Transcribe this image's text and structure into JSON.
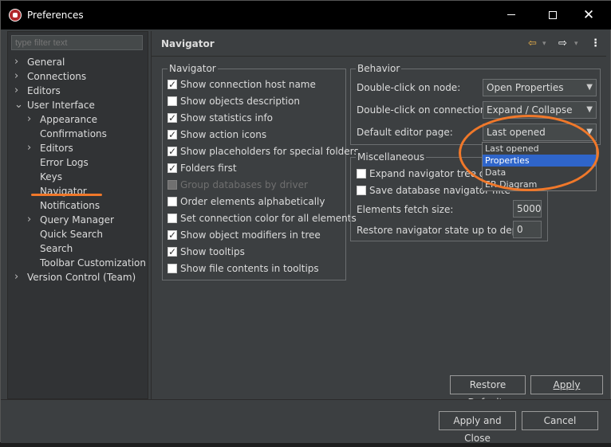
{
  "window": {
    "title": "Preferences",
    "minimize": "—",
    "close": "✕"
  },
  "filter": {
    "placeholder": "type filter text"
  },
  "tree": {
    "items": [
      {
        "label": "General"
      },
      {
        "label": "Connections"
      },
      {
        "label": "Editors"
      },
      {
        "label": "User Interface"
      },
      {
        "label": "Appearance"
      },
      {
        "label": "Confirmations"
      },
      {
        "label": "Editors"
      },
      {
        "label": "Error Logs"
      },
      {
        "label": "Keys"
      },
      {
        "label": "Navigator"
      },
      {
        "label": "Notifications"
      },
      {
        "label": "Query Manager"
      },
      {
        "label": "Quick Search"
      },
      {
        "label": "Search"
      },
      {
        "label": "Toolbar Customization"
      },
      {
        "label": "Version Control (Team)"
      }
    ]
  },
  "header": {
    "title": "Navigator",
    "back": "⇦",
    "forward": "⇨",
    "menu": "⋮",
    "dropdown": "▾"
  },
  "navigator_group": {
    "label": "Navigator",
    "options": [
      {
        "label": "Show connection host name",
        "checked": true
      },
      {
        "label": "Show objects description",
        "checked": false
      },
      {
        "label": "Show statistics info",
        "checked": true
      },
      {
        "label": "Show action icons",
        "checked": true
      },
      {
        "label": "Show placeholders for special folders",
        "checked": true
      },
      {
        "label": "Folders first",
        "checked": true
      },
      {
        "label": "Group databases by driver",
        "checked": false,
        "disabled": true
      },
      {
        "label": "Order elements alphabetically",
        "checked": false
      },
      {
        "label": "Set connection color for all elements",
        "checked": false
      },
      {
        "label": "Show object modifiers in tree",
        "checked": true
      },
      {
        "label": "Show tooltips",
        "checked": true
      },
      {
        "label": "Show file contents in tooltips",
        "checked": false
      }
    ]
  },
  "behavior_group": {
    "label": "Behavior",
    "double_click_node": {
      "label": "Double-click on node:",
      "value": "Open Properties"
    },
    "double_click_connection": {
      "label": "Double-click on connection:",
      "value": "Expand / Collapse"
    },
    "default_editor_page": {
      "label": "Default editor page:",
      "value": "Last opened"
    },
    "dropdown_options": [
      "Last opened",
      "Properties",
      "Data",
      "ER Diagram"
    ],
    "dropdown_selected": "Properties"
  },
  "misc_group": {
    "label": "Miscellaneous",
    "expand_tree": {
      "label": "Expand navigator tree on c",
      "checked": false
    },
    "save_state": {
      "label": "Save database navigator filte",
      "checked": false
    },
    "fetch_size": {
      "label": "Elements fetch size:",
      "value": "5000"
    },
    "restore_depth": {
      "label": "Restore navigator state up to depth:",
      "value": "0"
    }
  },
  "buttons": {
    "restore_defaults": "Restore Defaults",
    "apply": "Apply",
    "apply_and_close": "Apply and Close",
    "cancel": "Cancel"
  },
  "colors": {
    "annotation": "#f0782a",
    "selection": "#2f65ca"
  }
}
